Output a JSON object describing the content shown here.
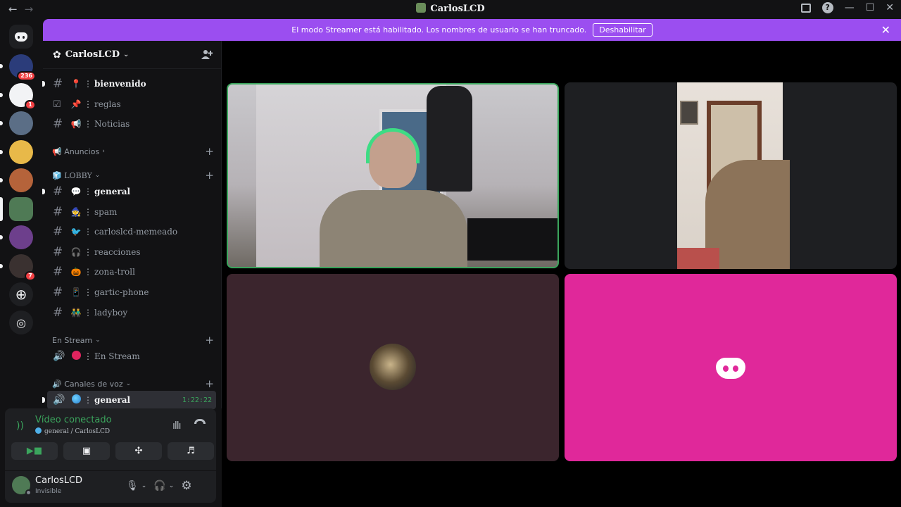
{
  "titlebar": {
    "title": "CarlosLCD",
    "back": "←",
    "forward": "→"
  },
  "guilds": [
    {
      "badge": "236",
      "color": "#2b3c7a"
    },
    {
      "badge": "1",
      "color": "#f2f3f5"
    },
    {
      "badge": "",
      "color": "#5b6e86"
    },
    {
      "badge": "",
      "color": "#e8b949"
    },
    {
      "badge": "",
      "color": "#b5633a"
    },
    {
      "badge": "",
      "color": "#4f7a55"
    },
    {
      "badge": "",
      "color": "#6d3f8c"
    },
    {
      "badge": "7",
      "color": "#3a3130"
    }
  ],
  "banner": {
    "text": "El modo Streamer está habilitado. Los nombres de usuario se han truncado.",
    "button": "Deshabilitar"
  },
  "server": {
    "name": "CarlosLCD"
  },
  "channels": {
    "top": [
      {
        "name": "bienvenido",
        "emoji": "📍",
        "type": "text"
      },
      {
        "name": "reglas",
        "emoji": "📌",
        "type": "rules"
      },
      {
        "name": "Noticias",
        "emoji": "📢",
        "type": "text"
      }
    ],
    "cat_anuncios": "📢 Anuncios",
    "cat_lobby": "🧊 LOBBY",
    "lobby": [
      {
        "name": "general",
        "emoji": "💬"
      },
      {
        "name": "spam",
        "emoji": "🧙"
      },
      {
        "name": "carloslcd-memeado",
        "emoji": "🐦"
      },
      {
        "name": "reacciones",
        "emoji": "🎧"
      },
      {
        "name": "zona-troll",
        "emoji": "🎃"
      },
      {
        "name": "gartic-phone",
        "emoji": "📱"
      },
      {
        "name": "ladyboy",
        "emoji": "👬"
      }
    ],
    "cat_stream": "En Stream",
    "stream_channel": "En Stream",
    "cat_voice": "🔊 Canales de voz",
    "voice_channel": "general",
    "voice_time": "1:22:22"
  },
  "voice": {
    "status": "Vídeo conectado",
    "location": "general / CarlosLCD"
  },
  "user": {
    "name": "CarlosLCD",
    "status": "Invisible"
  },
  "colors": {
    "streamer_banner": "#9b4ef0",
    "connected": "#3ba55d",
    "tile_pink": "#e0289a"
  }
}
